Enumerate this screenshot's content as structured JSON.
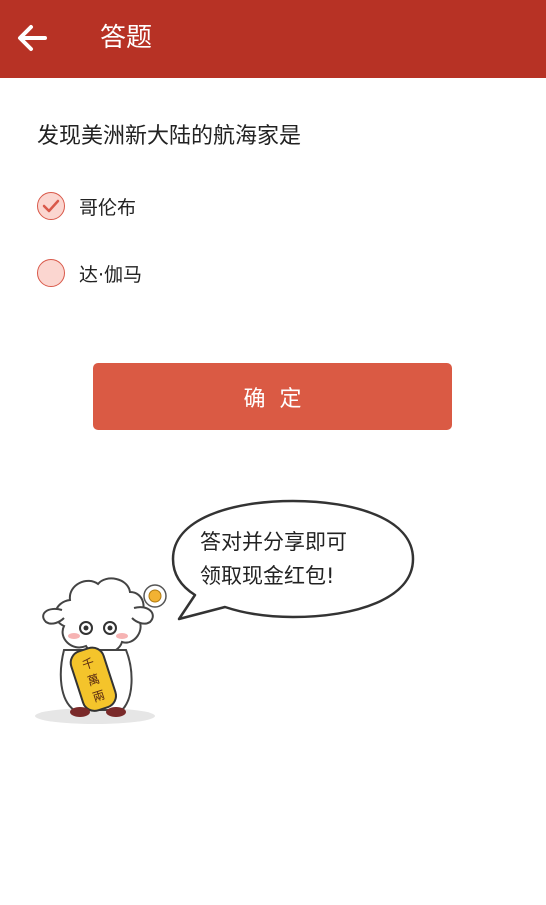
{
  "header": {
    "title": "答题"
  },
  "question": {
    "text": "发现美洲新大陆的航海家是",
    "options": [
      {
        "label": "哥伦布",
        "checked": true
      },
      {
        "label": "达·伽马",
        "checked": false
      }
    ]
  },
  "confirm_label": "确定",
  "promo": {
    "line1": "答对并分享即可",
    "line2": "领取现金红包!",
    "mascot_badge": "千萬兩"
  },
  "colors": {
    "header_bg": "#b73225",
    "button_bg": "#da5a44",
    "radio_fill": "#fbd6d0",
    "radio_stroke": "#d9594a"
  }
}
